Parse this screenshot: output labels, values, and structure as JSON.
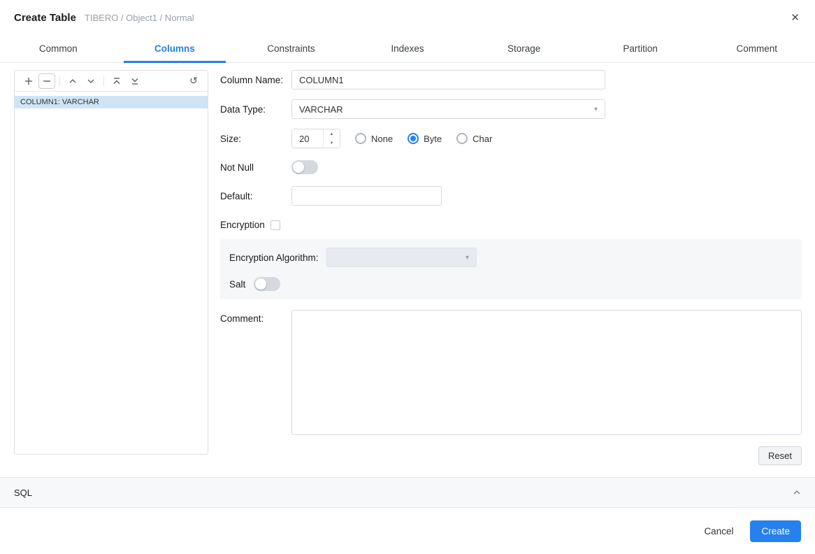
{
  "dialog": {
    "title": "Create Table",
    "subtitle": "TIBERO / Object1 / Normal"
  },
  "tabs": [
    {
      "label": "Common",
      "active": false
    },
    {
      "label": "Columns",
      "active": true
    },
    {
      "label": "Constraints",
      "active": false
    },
    {
      "label": "Indexes",
      "active": false
    },
    {
      "label": "Storage",
      "active": false
    },
    {
      "label": "Partition",
      "active": false
    },
    {
      "label": "Comment",
      "active": false
    }
  ],
  "column_list": {
    "toolbar_icons": [
      "add-icon",
      "remove-icon",
      "move-up-icon",
      "move-down-icon",
      "move-to-top-icon",
      "move-to-bottom-icon",
      "refresh-icon"
    ],
    "items": [
      {
        "label": "COLUMN1: VARCHAR",
        "selected": true
      }
    ]
  },
  "form": {
    "column_name": {
      "label": "Column Name:",
      "value": "COLUMN1"
    },
    "data_type": {
      "label": "Data Type:",
      "value": "VARCHAR"
    },
    "size": {
      "label": "Size:",
      "value": "20",
      "options": [
        "None",
        "Byte",
        "Char"
      ],
      "selected": "Byte"
    },
    "not_null": {
      "label": "Not Null",
      "on": false
    },
    "default": {
      "label": "Default:",
      "value": "",
      "placeholder": ""
    },
    "encryption": {
      "label": "Encryption",
      "checked": false
    },
    "encryption_panel": {
      "algorithm_label": "Encryption Algorithm:",
      "algorithm_value": "",
      "salt_label": "Salt",
      "salt_on": false
    },
    "comment": {
      "label": "Comment:",
      "value": ""
    },
    "reset_label": "Reset"
  },
  "sql_section": {
    "label": "SQL"
  },
  "footer": {
    "cancel_label": "Cancel",
    "create_label": "Create"
  },
  "colors": {
    "accent": "#2680ed",
    "selected_item_bg": "#cfe5f7",
    "panel_bg": "#f6f7f8"
  }
}
